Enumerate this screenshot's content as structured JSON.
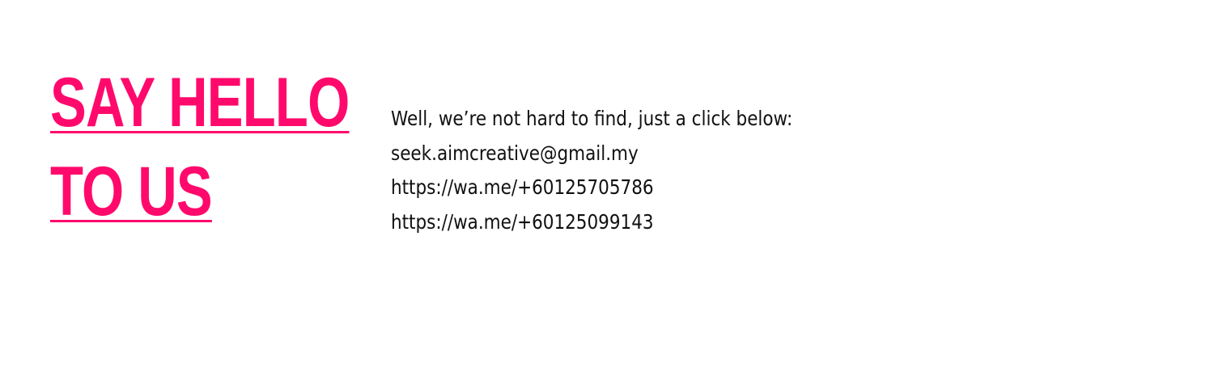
{
  "heading": {
    "line1": "SAY HELLO",
    "line2": "TO US"
  },
  "contact": {
    "intro": "Well, we’re not hard to find, just a click below:",
    "email": "seek.aimcreative@gmail.my",
    "whatsapp_1": "https://wa.me/+60125705786",
    "whatsapp_2": "https://wa.me/+60125099143"
  },
  "colors": {
    "accent": "#ff0a6c",
    "text": "#111111",
    "background": "#ffffff"
  }
}
